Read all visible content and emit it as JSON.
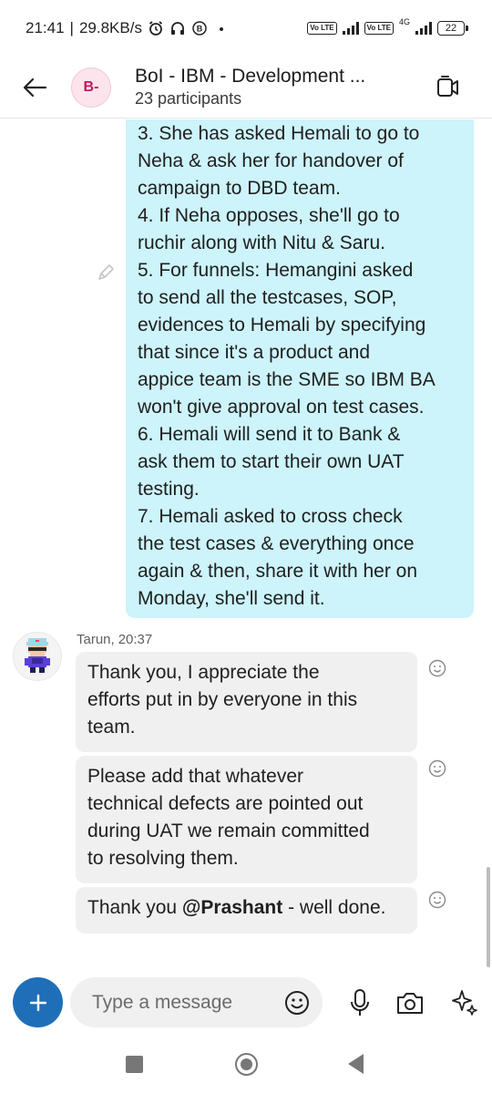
{
  "status_bar": {
    "time": "21:41",
    "separator": "|",
    "network_speed": "29.8KB/s",
    "network_type": "4G",
    "volte": "Vo LTE",
    "battery": "22"
  },
  "header": {
    "avatar_initials": "B-",
    "title": "BoI - IBM - Development ...",
    "subtitle": "23 participants"
  },
  "messages": {
    "outgoing": {
      "lines": [
        "3. She has asked Hemali to go to",
        "Neha & ask her for handover of",
        "campaign to DBD team.",
        "4. If Neha opposes, she'll go to",
        "ruchir along with Nitu & Saru.",
        "5. For funnels: Hemangini asked",
        "to send all the testcases, SOP,",
        "evidences to Hemali by specifying",
        "that since it's a product and",
        "appice team is the SME so IBM BA",
        "won't give approval on test cases.",
        "6. Hemali will send it to Bank &",
        "ask them to start their own UAT",
        "testing.",
        "7. Hemali asked to cross check",
        "the test cases & everything once",
        "again & then, share it with her on",
        "Monday, she'll send it."
      ]
    },
    "incoming": {
      "sender": "Tarun,",
      "time": "20:37",
      "bubbles": [
        {
          "lines": [
            "Thank you, I appreciate the",
            "efforts put in by everyone in this",
            "team."
          ]
        },
        {
          "lines": [
            "Please add that whatever",
            "technical defects are pointed out",
            "during UAT we remain committed",
            "to resolving them."
          ]
        },
        {
          "prefix": "Thank you ",
          "mention": "@Prashant",
          "suffix": " - well done."
        }
      ]
    }
  },
  "composer": {
    "placeholder": "Type a message"
  },
  "colors": {
    "outgoing_bubble": "#cdf4fb",
    "incoming_bubble": "#f0f0f0",
    "plus_button": "#1f6fb8",
    "avatar_bg": "#fce4ec",
    "avatar_text": "#c2185b"
  },
  "icons": {
    "back": "arrow-left-icon",
    "video": "video-call-icon",
    "edit": "pencil-icon",
    "react": "smiley-icon",
    "add": "plus-icon",
    "emoji": "emoji-icon",
    "mic": "mic-icon",
    "camera": "camera-icon",
    "copilot": "sparkle-icon"
  }
}
